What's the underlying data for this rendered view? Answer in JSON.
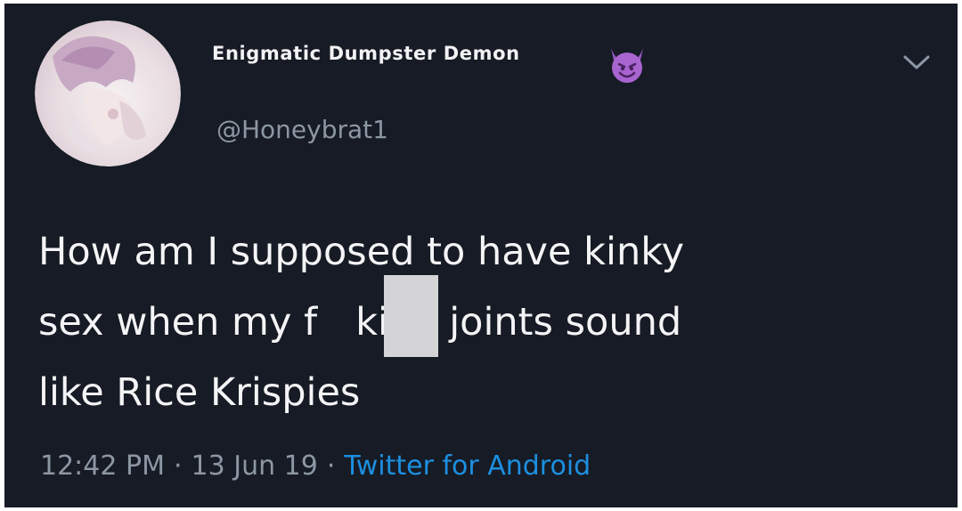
{
  "tweet": {
    "display_name": "Enigmatic Dumpster Demon",
    "display_name_icon": "smiling-devil-emoji",
    "handle": "@Honeybrat1",
    "text_lines": [
      "How am I supposed to have kinky",
      "sex when my f  king joints sound",
      "like Rice Krispies"
    ],
    "time": "12:42 PM",
    "separator": "·",
    "date": "13 Jun 19",
    "source": "Twitter for Android",
    "menu_icon": "chevron-down-icon"
  },
  "colors": {
    "background": "#161b25",
    "text": "#f4f4f6",
    "muted": "#8d96a3",
    "link": "#1d8fe0",
    "censor": "#d4d4d6"
  }
}
